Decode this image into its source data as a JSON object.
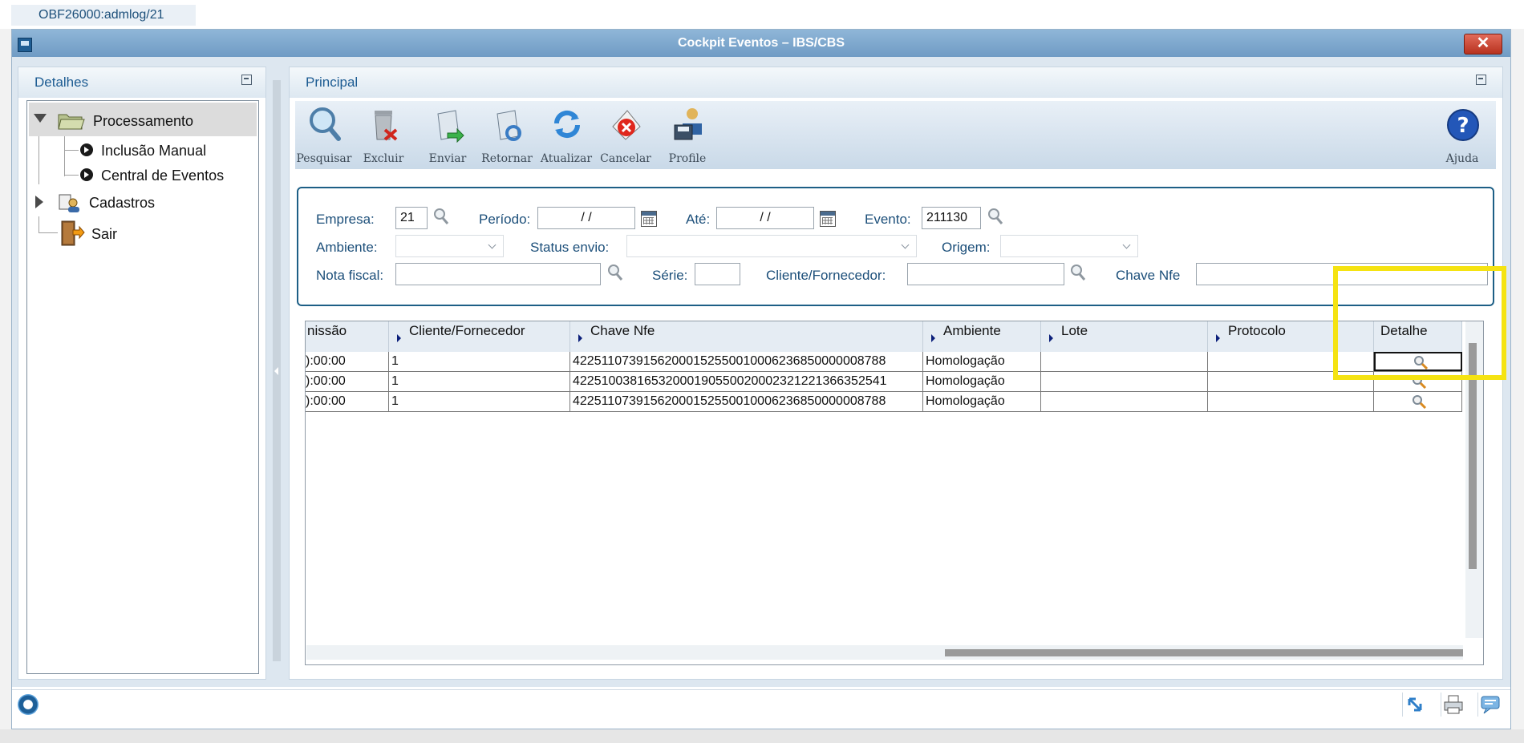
{
  "tab": {
    "label": "OBF26000:admlog/21"
  },
  "window": {
    "title": "Cockpit Eventos – IBS/CBS",
    "close_label": "✕"
  },
  "left_panel": {
    "title": "Detalhes",
    "tree": {
      "root": "Processamento",
      "children": [
        "Inclusão Manual",
        "Central de Eventos"
      ],
      "cadastros": "Cadastros",
      "sair": "Sair"
    }
  },
  "right_panel": {
    "title": "Principal"
  },
  "toolbar": {
    "pesquisar": "Pesquisar",
    "excluir": "Excluir",
    "enviar": "Enviar",
    "retornar": "Retornar",
    "atualizar": "Atualizar",
    "cancelar": "Cancelar",
    "profile": "Profile",
    "ajuda": "Ajuda"
  },
  "filters": {
    "empresa_label": "Empresa:",
    "empresa_value": "21",
    "periodo_label": "Período:",
    "periodo_value": "/ /",
    "ate_label": "Até:",
    "ate_value": "/ /",
    "evento_label": "Evento:",
    "evento_value": "211130",
    "ambiente_label": "Ambiente:",
    "status_envio_label": "Status envio:",
    "origem_label": "Origem:",
    "nota_fiscal_label": "Nota fiscal:",
    "serie_label": "Série:",
    "cliente_fornecedor_label": "Cliente/Fornecedor:",
    "chave_nfe_label": "Chave Nfe"
  },
  "grid": {
    "columns": [
      "nissão",
      "Cliente/Fornecedor",
      "Chave Nfe",
      "Ambiente",
      "Lote",
      "Protocolo",
      "Detalhe"
    ],
    "rows": [
      {
        "emissao": "):00:00",
        "cliente": "1",
        "chave": "42251107391562000152550010006236850000008788",
        "ambiente": "Homologação",
        "lote": "",
        "protocolo": ""
      },
      {
        "emissao": "):00:00",
        "cliente": "1",
        "chave": "42251003816532000190550020002321221366352541",
        "ambiente": "Homologação",
        "lote": "",
        "protocolo": ""
      },
      {
        "emissao": "):00:00",
        "cliente": "1",
        "chave": "42251107391562000152550010006236850000008788",
        "ambiente": "Homologação",
        "lote": "",
        "protocolo": ""
      }
    ]
  },
  "colors": {
    "highlight": "#f5e312",
    "title_bar": "#7fa8cf",
    "accent": "#1c5b92"
  }
}
